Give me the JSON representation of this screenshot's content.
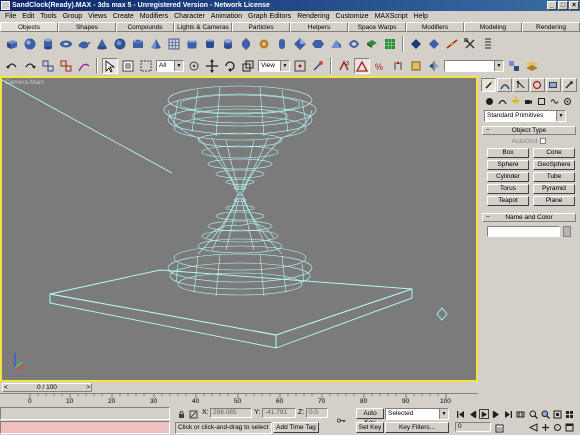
{
  "window": {
    "title": "SandClock(Ready).MAX - 3ds max 5 - Unregistered Version - Network License"
  },
  "menu": [
    "File",
    "Edit",
    "Tools",
    "Group",
    "Views",
    "Create",
    "Modifiers",
    "Character",
    "Animation",
    "Graph Editors",
    "Rendering",
    "Customize",
    "MAXScript",
    "Help"
  ],
  "tabs": [
    "Objects",
    "Shapes",
    "Compounds",
    "Lights & Cameras",
    "Particles",
    "Helpers",
    "Space Warps",
    "Modifiers",
    "Modeling",
    "Rendering"
  ],
  "active_tab": "Objects",
  "toolbar": {
    "selection_filter": "All",
    "coordinate_system": "View"
  },
  "viewport": {
    "label": "Camera.Main"
  },
  "command_panel": {
    "category": "Standard Primitives",
    "object_type_header": "Object Type",
    "autogrid_label": "AutoGrid",
    "buttons": [
      "Box",
      "Cone",
      "Sphere",
      "GeoSphere",
      "Cylinder",
      "Tube",
      "Torus",
      "Pyramid",
      "Teapot",
      "Plane"
    ],
    "name_color_header": "Name and Color"
  },
  "timeline": {
    "frame_label": "0 / 100",
    "ruler_ticks": [
      "0",
      "10",
      "20",
      "30",
      "40",
      "50",
      "60",
      "70",
      "80",
      "90",
      "100"
    ]
  },
  "status": {
    "x_label": "X:",
    "x_value": "286.085",
    "y_label": "Y:",
    "y_value": "-41.791",
    "z_label": "Z:",
    "z_value": "0.0",
    "prompt": "Click or click-and-drag to select ob",
    "add_time_tag": "Add Time Tag",
    "auto_key": "Auto Key",
    "key_mode": "Selected",
    "set_key": "Set Key",
    "key_filters": "Key Filters...",
    "current_frame": "0"
  }
}
